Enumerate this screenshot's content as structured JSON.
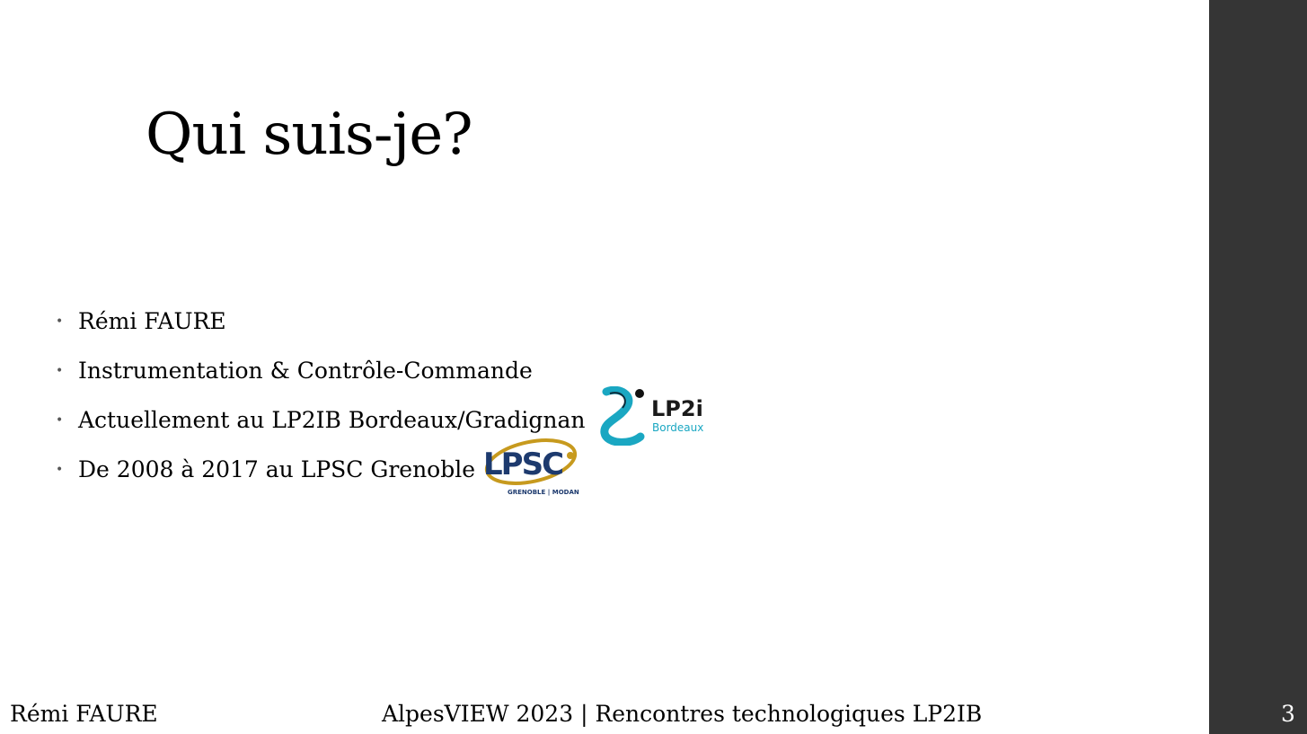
{
  "slide": {
    "title": "Qui suis-je?",
    "bullets": [
      {
        "text": "Rémi FAURE"
      },
      {
        "text": "Instrumentation & Contrôle-Commande"
      },
      {
        "text": "Actuellement au LP2IB Bordeaux/Gradignan"
      },
      {
        "text": "De 2008 à 2017 au LPSC Grenoble"
      }
    ],
    "bullet_glyph": "•",
    "logos": {
      "lp2i": {
        "name": "LP2i",
        "sub": "Bordeaux",
        "colors": {
          "swirl": "#1aa7c2",
          "text": "#1a1a1a",
          "sub": "#1aa7c2"
        }
      },
      "lpsc": {
        "name": "LPSC",
        "sub": "GRENOBLE | MODANE",
        "colors": {
          "text": "#1d3a6e",
          "swoosh": "#c79a1e"
        }
      }
    }
  },
  "footer": {
    "author": "Rémi FAURE",
    "event": "AlpesVIEW 2023 | Rencontres technologiques LP2IB",
    "page_number": "3"
  },
  "theme": {
    "sidebar_color": "#353535",
    "background": "#ffffff"
  }
}
